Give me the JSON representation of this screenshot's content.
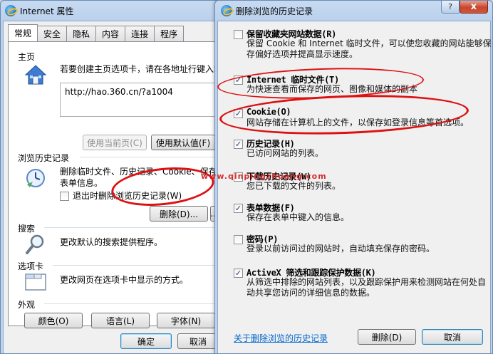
{
  "left_window": {
    "title": "Internet 属性",
    "tabs": [
      "常规",
      "安全",
      "隐私",
      "内容",
      "连接",
      "程序"
    ],
    "home": {
      "section": "主页",
      "desc": "若要创建主页选项卡，请在各地址行键入地",
      "url": "http://hao.360.cn/?a1004",
      "use_current": "使用当前页(C)",
      "use_default": "使用默认值(F)"
    },
    "history": {
      "section": "浏览历史记录",
      "desc_line1": "删除临时文件、历史记录、Cookie、保存的",
      "desc_line2": "表单信息。",
      "exit_delete": "退出时删除浏览历史记录(W)",
      "delete_btn": "删除(D)...",
      "settings_btn": "..."
    },
    "search": {
      "section": "搜索",
      "desc": "更改默认的搜索提供程序。"
    },
    "tabs_section": {
      "section": "选项卡",
      "desc": "更改网页在选项卡中显示的方式。"
    },
    "appearance": {
      "section": "外观",
      "colors": "颜色(O)",
      "languages": "语言(L)",
      "fonts": "字体(N)"
    },
    "ok": "确定",
    "cancel": "取消"
  },
  "right_window": {
    "title": "删除浏览的历史记录",
    "items": [
      {
        "title": "保留收藏夹网站数据(R)",
        "desc": [
          "保留 Cookie 和 Internet 临时文件，可以使您收藏的网站能够保",
          "存偏好选项并提高显示速度。"
        ],
        "checked": false
      },
      {
        "title": "Internet 临时文件(T)",
        "desc": [
          "为快速查看而保存的网页、图像和媒体的副本"
        ],
        "checked": true
      },
      {
        "title": "Cookie(O)",
        "desc": [
          "网站存储在计算机上的文件，以保存如登录信息等首选项。"
        ],
        "checked": true
      },
      {
        "title": "历史记录(H)",
        "desc": [
          "已访问网站的列表。"
        ],
        "checked": true
      },
      {
        "title": "下载历史记录(W)",
        "desc": [
          "您已下载的文件的列表。"
        ],
        "checked": false
      },
      {
        "title": "表单数据(F)",
        "desc": [
          "保存在表单中键入的信息。"
        ],
        "checked": true
      },
      {
        "title": "密码(P)",
        "desc": [
          "登录以前访问过的网站时，自动填充保存的密码。"
        ],
        "checked": false
      },
      {
        "title": "ActiveX 筛选和跟踪保护数据(K)",
        "desc": [
          "从筛选中排除的网站列表，以及跟踪保护用来检测网站在何处自",
          "动共享您访问的详细信息的数据。"
        ],
        "checked": true
      }
    ],
    "about_link": "关于删除浏览的历史记录",
    "delete_btn": "删除(D)",
    "cancel_btn": "取消",
    "close_glyph": "x",
    "help_glyph": "?"
  },
  "watermark": "www.qinpingzhuang.com"
}
